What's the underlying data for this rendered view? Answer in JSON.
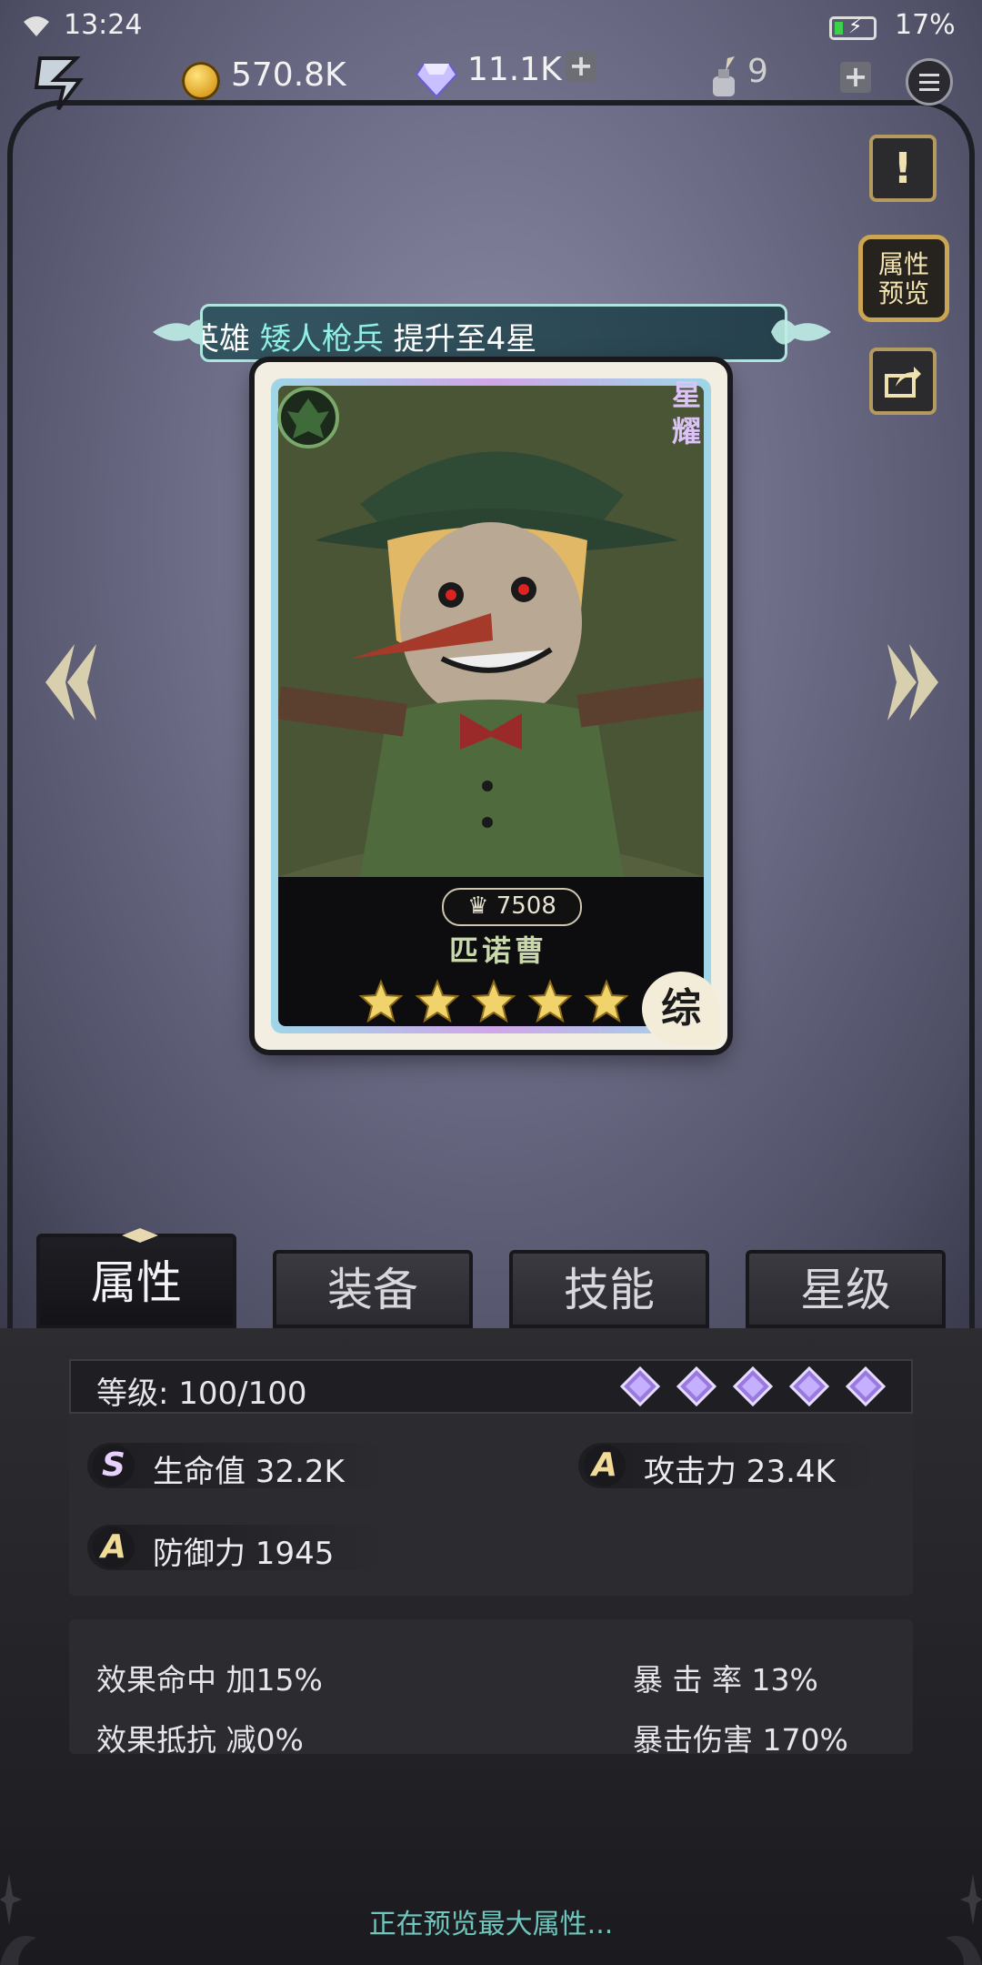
{
  "status_bar": {
    "time": "13:24",
    "battery_pct": "17%"
  },
  "currency": {
    "gold": "570.8K",
    "gems": "11.1K",
    "ink": "9"
  },
  "side_buttons": {
    "notice": "!",
    "attr_preview_line1": "属性",
    "attr_preview_line2": "预览"
  },
  "banner": {
    "prefix": "英雄",
    "hero_class": "矮人枪兵",
    "suffix": "提升至4星"
  },
  "card": {
    "power": "7508",
    "name": "匹诺曹",
    "stars": 5,
    "side_tag": "星耀",
    "type_badge": "综"
  },
  "tabs": [
    {
      "label": "属性",
      "active": true
    },
    {
      "label": "装备",
      "active": false
    },
    {
      "label": "技能",
      "active": false
    },
    {
      "label": "星级",
      "active": false
    }
  ],
  "attributes": {
    "level_label": "等级: 100/100",
    "rank_gems": 5,
    "hp": {
      "rank": "S",
      "text": "生命值 32.2K"
    },
    "attack": {
      "rank": "A",
      "text": "攻击力 23.4K"
    },
    "defense": {
      "rank": "A",
      "text": "防御力 1945"
    }
  },
  "secondary": {
    "effect_hit": "效果命中  加15%",
    "crit_rate": "暴 击 率    13%",
    "effect_resist": "效果抵抗  减0%",
    "crit_damage": "暴击伤害  170%"
  },
  "footer_note": "正在预览最大属性...",
  "colors": {
    "accent_teal": "#8ff0e4",
    "gold_border": "#caa552",
    "rank_gold": "#f0dc96"
  }
}
